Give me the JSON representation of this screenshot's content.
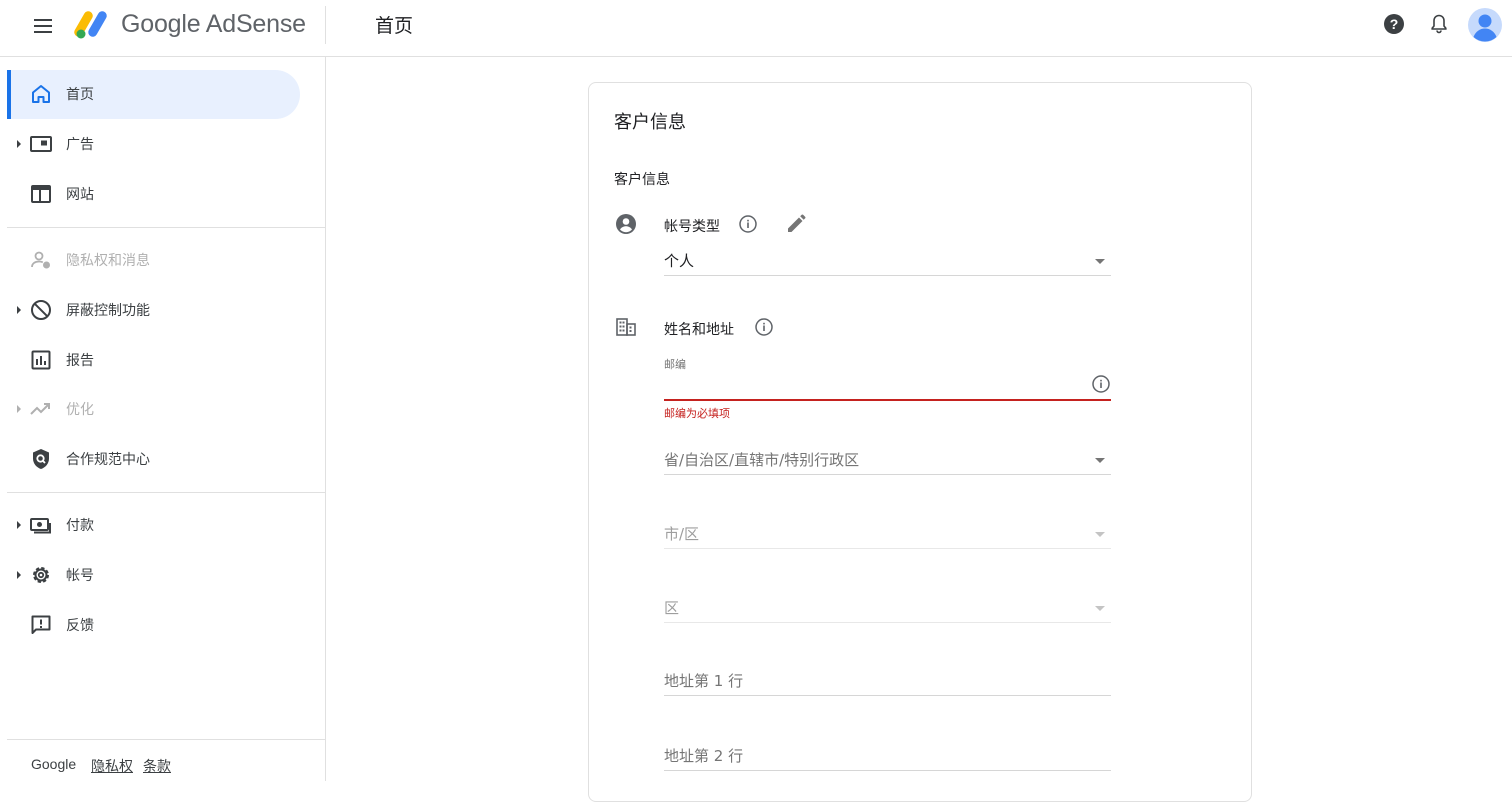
{
  "header": {
    "brand": "Google AdSense",
    "page_title": "首页"
  },
  "sidebar": {
    "items": [
      {
        "label": "首页",
        "icon": "home-icon"
      },
      {
        "label": "广告",
        "icon": "ads-icon"
      },
      {
        "label": "网站",
        "icon": "sites-icon"
      },
      {
        "label": "隐私权和消息",
        "icon": "privacy-messages-icon"
      },
      {
        "label": "屏蔽控制功能",
        "icon": "block-icon"
      },
      {
        "label": "报告",
        "icon": "reports-icon"
      },
      {
        "label": "优化",
        "icon": "optimize-icon"
      },
      {
        "label": "合作规范中心",
        "icon": "policy-center-icon"
      },
      {
        "label": "付款",
        "icon": "payments-icon"
      },
      {
        "label": "帐号",
        "icon": "account-gear-icon"
      },
      {
        "label": "反馈",
        "icon": "feedback-icon"
      }
    ],
    "footer": {
      "google": "Google",
      "privacy": "隐私权",
      "terms": "条款"
    }
  },
  "card": {
    "title": "客户信息",
    "section_title": "客户信息",
    "account_type": {
      "label": "帐号类型",
      "value": "个人"
    },
    "name_address": {
      "label": "姓名和地址",
      "postal_code_label": "邮编",
      "postal_code_value": "",
      "postal_code_error": "邮编为必填项",
      "province_placeholder": "省/自治区/直辖市/特别行政区",
      "city_placeholder": "市/区",
      "district_placeholder": "区",
      "address_line1_placeholder": "地址第 1 行",
      "address_line2_placeholder": "地址第 2 行"
    }
  },
  "colors": {
    "accent": "#1a73e8",
    "active_bg": "#e8f0fe",
    "error": "#c5221f"
  }
}
